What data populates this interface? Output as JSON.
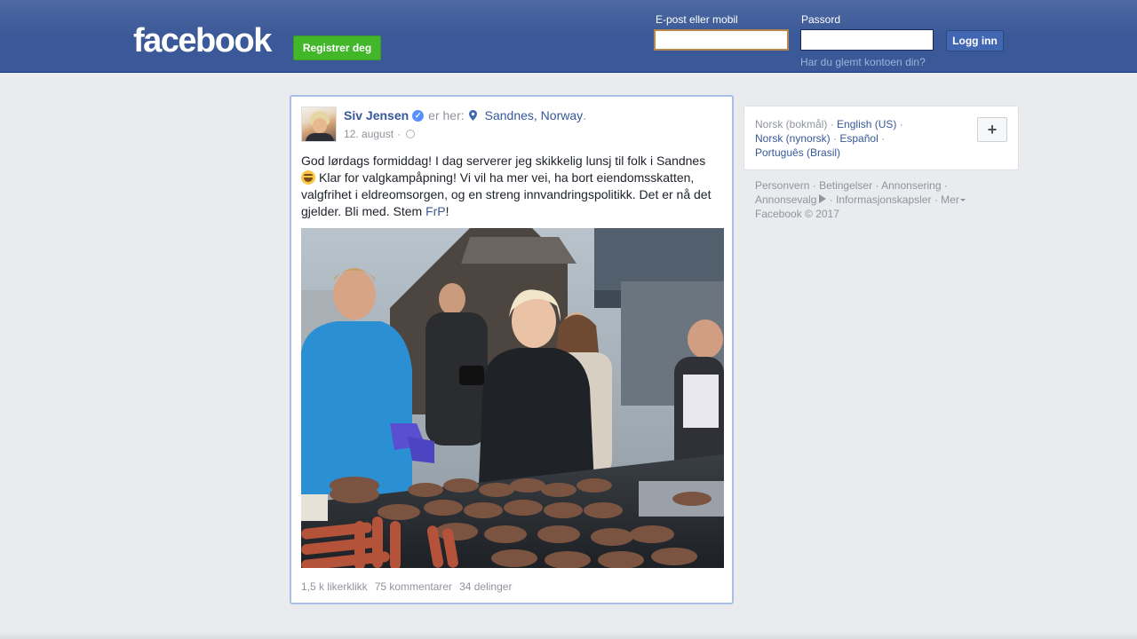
{
  "header": {
    "logo": "facebook",
    "signup_label": "Registrer deg",
    "email_label": "E-post eller mobil",
    "email_value": "",
    "password_label": "Passord",
    "password_value": "",
    "login_label": "Logg inn",
    "forgot_label": "Har du glemt kontoen din?",
    "brand_color": "#3b5998"
  },
  "post": {
    "author": "Siv Jensen",
    "verified_icon": "verified-check-icon",
    "is_here": "er her:",
    "place": "Sandnes, Norway",
    "place_end": ".",
    "date": "12. august",
    "date_sep": "·",
    "privacy_icon": "globe-icon",
    "text_1": "God lørdags formiddag! I dag serverer jeg skikkelig lunsj til folk i Sandnes",
    "text_2": "Klar for valgkampåpning! Vi vil ha mer vei, ha bort eiendomsskatten, valgfrihet i eldreomsorgen, og en streng innvandringspolitikk. Det er nå det gjelder. Bli med. Stem",
    "hashtag_link": "FrP",
    "text_end": "!",
    "likes": "1,5 k likerklikk",
    "comments": "75 kommentarer",
    "shares": "34 delinger"
  },
  "languages": {
    "current": "Norsk (bokmål)",
    "sep": "·",
    "items": [
      "English (US)",
      "Norsk (nynorsk)",
      "Español",
      "Português (Brasil)"
    ],
    "more_label": "+"
  },
  "footer": {
    "privacy": "Personvern",
    "terms": "Betingelser",
    "advertising": "Annonsering",
    "ad_choices": "Annonsevalg",
    "cookies": "Informasjonskapsler",
    "more": "Mer",
    "sep": "·",
    "copyright": "Facebook © 2017"
  }
}
